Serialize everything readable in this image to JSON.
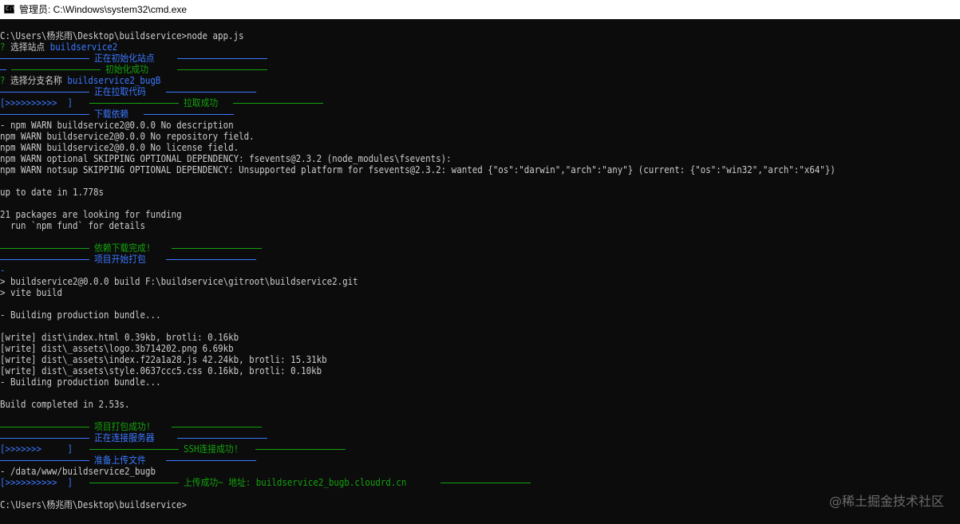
{
  "window": {
    "title": "管理员: C:\\Windows\\system32\\cmd.exe",
    "icon": "console-icon"
  },
  "console": {
    "cmd_prompt": "C:\\Users\\杨兆雨\\Desktop\\buildservice>node app.js",
    "q_mark_1": "?",
    "select_site_label": " 选择站点 ",
    "select_site_value": "buildservice2",
    "init_site": "正在初始化站点",
    "init_success": "初始化成功",
    "q_mark_2": "?",
    "select_branch_label": " 选择分支名称 ",
    "select_branch_value": "buildservice2_bugB",
    "pulling_code": "正在拉取代码",
    "pull_progress": "[>>>>>>>>>>  ]",
    "pull_success": "拉取成功",
    "download_deps": "下载依赖",
    "npm_lines": [
      "- npm WARN buildservice2@0.0.0 No description",
      "npm WARN buildservice2@0.0.0 No repository field.",
      "npm WARN buildservice2@0.0.0 No license field.",
      "npm WARN optional SKIPPING OPTIONAL DEPENDENCY: fsevents@2.3.2 (node_modules\\fsevents):",
      "npm WARN notsup SKIPPING OPTIONAL DEPENDENCY: Unsupported platform for fsevents@2.3.2: wanted {\"os\":\"darwin\",\"arch\":\"any\"} (current: {\"os\":\"win32\",\"arch\":\"x64\"})"
    ],
    "up_to_date": "up to date in 1.778s",
    "funding_1": "21 packages are looking for funding",
    "funding_2": "  run `npm fund` for details",
    "deps_done": "依赖下载完成!",
    "build_start": "项目开始打包",
    "dash_line": "-",
    "build_cmd": "> buildservice2@0.0.0 build F:\\buildservice\\gitroot\\buildservice2.git",
    "vite_cmd": "> vite build",
    "building_1": "- Building production bundle...",
    "write_lines": [
      "[write] dist\\index.html 0.39kb, brotli: 0.16kb",
      "[write] dist\\_assets\\logo.3b714202.png 6.69kb",
      "[write] dist\\_assets\\index.f22a1a28.js 42.24kb, brotli: 15.31kb",
      "[write] dist\\_assets\\style.0637ccc5.css 0.16kb, brotli: 0.10kb"
    ],
    "building_2": "- Building production bundle...",
    "build_completed": "Build completed in 2.53s.",
    "build_success": "项目打包成功!",
    "connecting_server": "正在连接服务器",
    "ssh_progress": "[>>>>>>>     ]",
    "ssh_success": "SSH连接成功!",
    "prepare_upload": "准备上传文件",
    "upload_path": "- /data/www/buildservice2_bugb",
    "upload_progress": "[>>>>>>>>>>  ]",
    "upload_success": "上传成功~ 地址: buildservice2_bugb.cloudrd.cn",
    "final_prompt": "C:\\Users\\杨兆雨\\Desktop\\buildservice>"
  },
  "watermark": "@稀土掘金技术社区",
  "colors": {
    "background": "#0c0c0c",
    "text": "#cccccc",
    "green": "#13a10e",
    "blue": "#3b78ff"
  }
}
